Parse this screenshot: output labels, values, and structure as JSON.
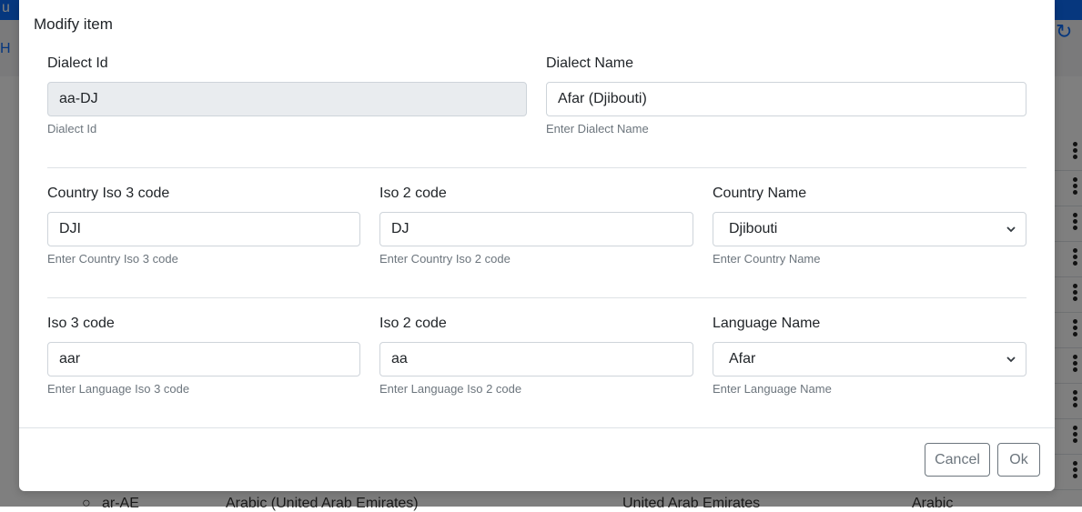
{
  "background": {
    "topbar_text": "u",
    "toolbar_label": "H",
    "last_row": {
      "id": "ar-AE",
      "dialect": "Arabic (United Arab Emirates)",
      "country": "United Arab Emirates",
      "language": "Arabic"
    }
  },
  "modal": {
    "title": "Modify item",
    "dialect_id": {
      "label": "Dialect Id",
      "value": "aa-DJ",
      "help": "Dialect Id"
    },
    "dialect_name": {
      "label": "Dialect Name",
      "value": "Afar (Djibouti)",
      "help": "Enter Dialect Name"
    },
    "country_iso3": {
      "label": "Country Iso 3 code",
      "value": "DJI",
      "help": "Enter Country Iso 3 code"
    },
    "country_iso2": {
      "label": "Iso 2 code",
      "value": "DJ",
      "help": "Enter Country Iso 2 code"
    },
    "country_name": {
      "label": "Country Name",
      "value": "Djibouti",
      "help": "Enter Country Name"
    },
    "language_iso3": {
      "label": "Iso 3 code",
      "value": "aar",
      "help": "Enter Language Iso 3 code"
    },
    "language_iso2": {
      "label": "Iso 2 code",
      "value": "aa",
      "help": "Enter Language Iso 2 code"
    },
    "language_name": {
      "label": "Language Name",
      "value": "Afar",
      "help": "Enter Language Name"
    },
    "cancel_label": "Cancel",
    "ok_label": "Ok"
  },
  "colors": {
    "primary": "#0d6efd",
    "backdrop": "rgba(0,0,0,0.5)",
    "muted_text": "#6c757d"
  }
}
